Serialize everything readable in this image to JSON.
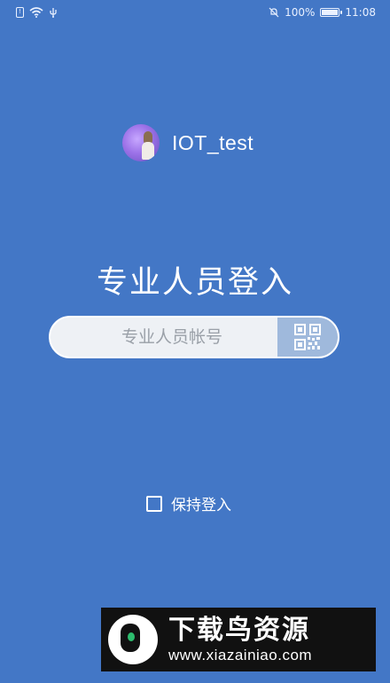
{
  "status_bar": {
    "sim_icon": "sim-alert-icon",
    "wifi_icon": "wifi-icon",
    "usb_icon": "usb-icon",
    "mute_icon": "bell-off-icon",
    "battery_text": "100%",
    "battery_level": 1.0,
    "time": "11:08"
  },
  "brand": {
    "avatar_icon": "app-avatar",
    "name": "IOT_test"
  },
  "login": {
    "title": "专业人员登入",
    "account_placeholder": "专业人员帐号",
    "account_value": "",
    "scan_icon": "qr-code-icon"
  },
  "remember": {
    "label": "保持登入",
    "checked": false
  },
  "watermark": {
    "title": "下载鸟资源",
    "url": "www.xiazainiao.com"
  },
  "colors": {
    "background": "#4377c6",
    "input_bg": "#eef1f5",
    "scan_bg": "#9fb9dc",
    "watermark_bg": "#111111"
  }
}
